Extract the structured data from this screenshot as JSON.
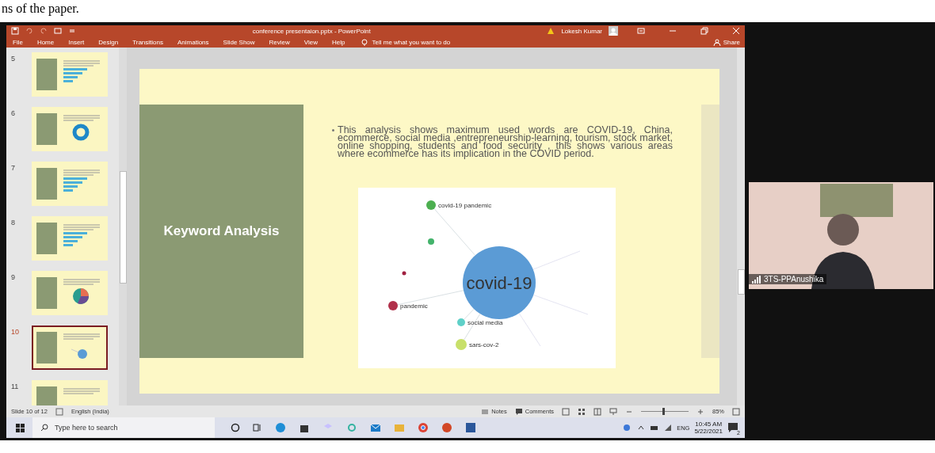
{
  "document_text": "ns of the paper.",
  "window": {
    "title": "conference presentaion.pptx  -  PowerPoint",
    "user": "Lokesh Kumar"
  },
  "ribbon": {
    "tabs": [
      {
        "label": "File",
        "selected": false
      },
      {
        "label": "Home",
        "selected": false
      },
      {
        "label": "Insert",
        "selected": false
      },
      {
        "label": "Design",
        "selected": false
      },
      {
        "label": "Transitions",
        "selected": false
      },
      {
        "label": "Animations",
        "selected": false
      },
      {
        "label": "Slide Show",
        "selected": false
      },
      {
        "label": "Review",
        "selected": false
      },
      {
        "label": "View",
        "selected": false
      },
      {
        "label": "Help",
        "selected": false
      }
    ],
    "tell_me": "Tell me what you want to do",
    "share": "Share"
  },
  "thumbnails": [
    {
      "number": "5",
      "kind": "bar",
      "selected": false
    },
    {
      "number": "6",
      "kind": "donut",
      "selected": false
    },
    {
      "number": "7",
      "kind": "bar",
      "selected": false
    },
    {
      "number": "8",
      "kind": "bar",
      "selected": false
    },
    {
      "number": "9",
      "kind": "pie",
      "selected": false
    },
    {
      "number": "10",
      "kind": "network",
      "selected": true
    },
    {
      "number": "11",
      "kind": "blank",
      "selected": false
    }
  ],
  "slide": {
    "title": "Keyword Analysis",
    "bullet": "This analysis shows maximum used words are COVID-19, China, ecommerce, social media ,entrepreneurship-learning, tourism, stock market, online shopping, students  and food security , this shows various areas where ecommerce has its implication in the COVID period.",
    "network": {
      "nodes": [
        {
          "label": "covid-19 pandemic",
          "color": "#4caf50",
          "kind": "term"
        },
        {
          "label": "covid-19",
          "color": "#5b9bd5",
          "kind": "main"
        },
        {
          "label": "pandemic",
          "color": "#b0304a",
          "kind": "term"
        },
        {
          "label": "social media",
          "color": "#5fd0c8",
          "kind": "term"
        },
        {
          "label": "sars-cov-2",
          "color": "#c8e06a",
          "kind": "term"
        }
      ]
    }
  },
  "status_bar": {
    "slide_count": "Slide 10 of 12",
    "language": "English (India)",
    "notes": "Notes",
    "comments": "Comments",
    "zoom": {
      "level": 0.45,
      "reading": "85%"
    }
  },
  "taskbar": {
    "search_placeholder": "Type here to search",
    "language": "ENG",
    "time": "10:45 AM",
    "date": "5/22/2021",
    "notifications": "2"
  },
  "participant": {
    "name": "3TS-PPAnushika"
  }
}
